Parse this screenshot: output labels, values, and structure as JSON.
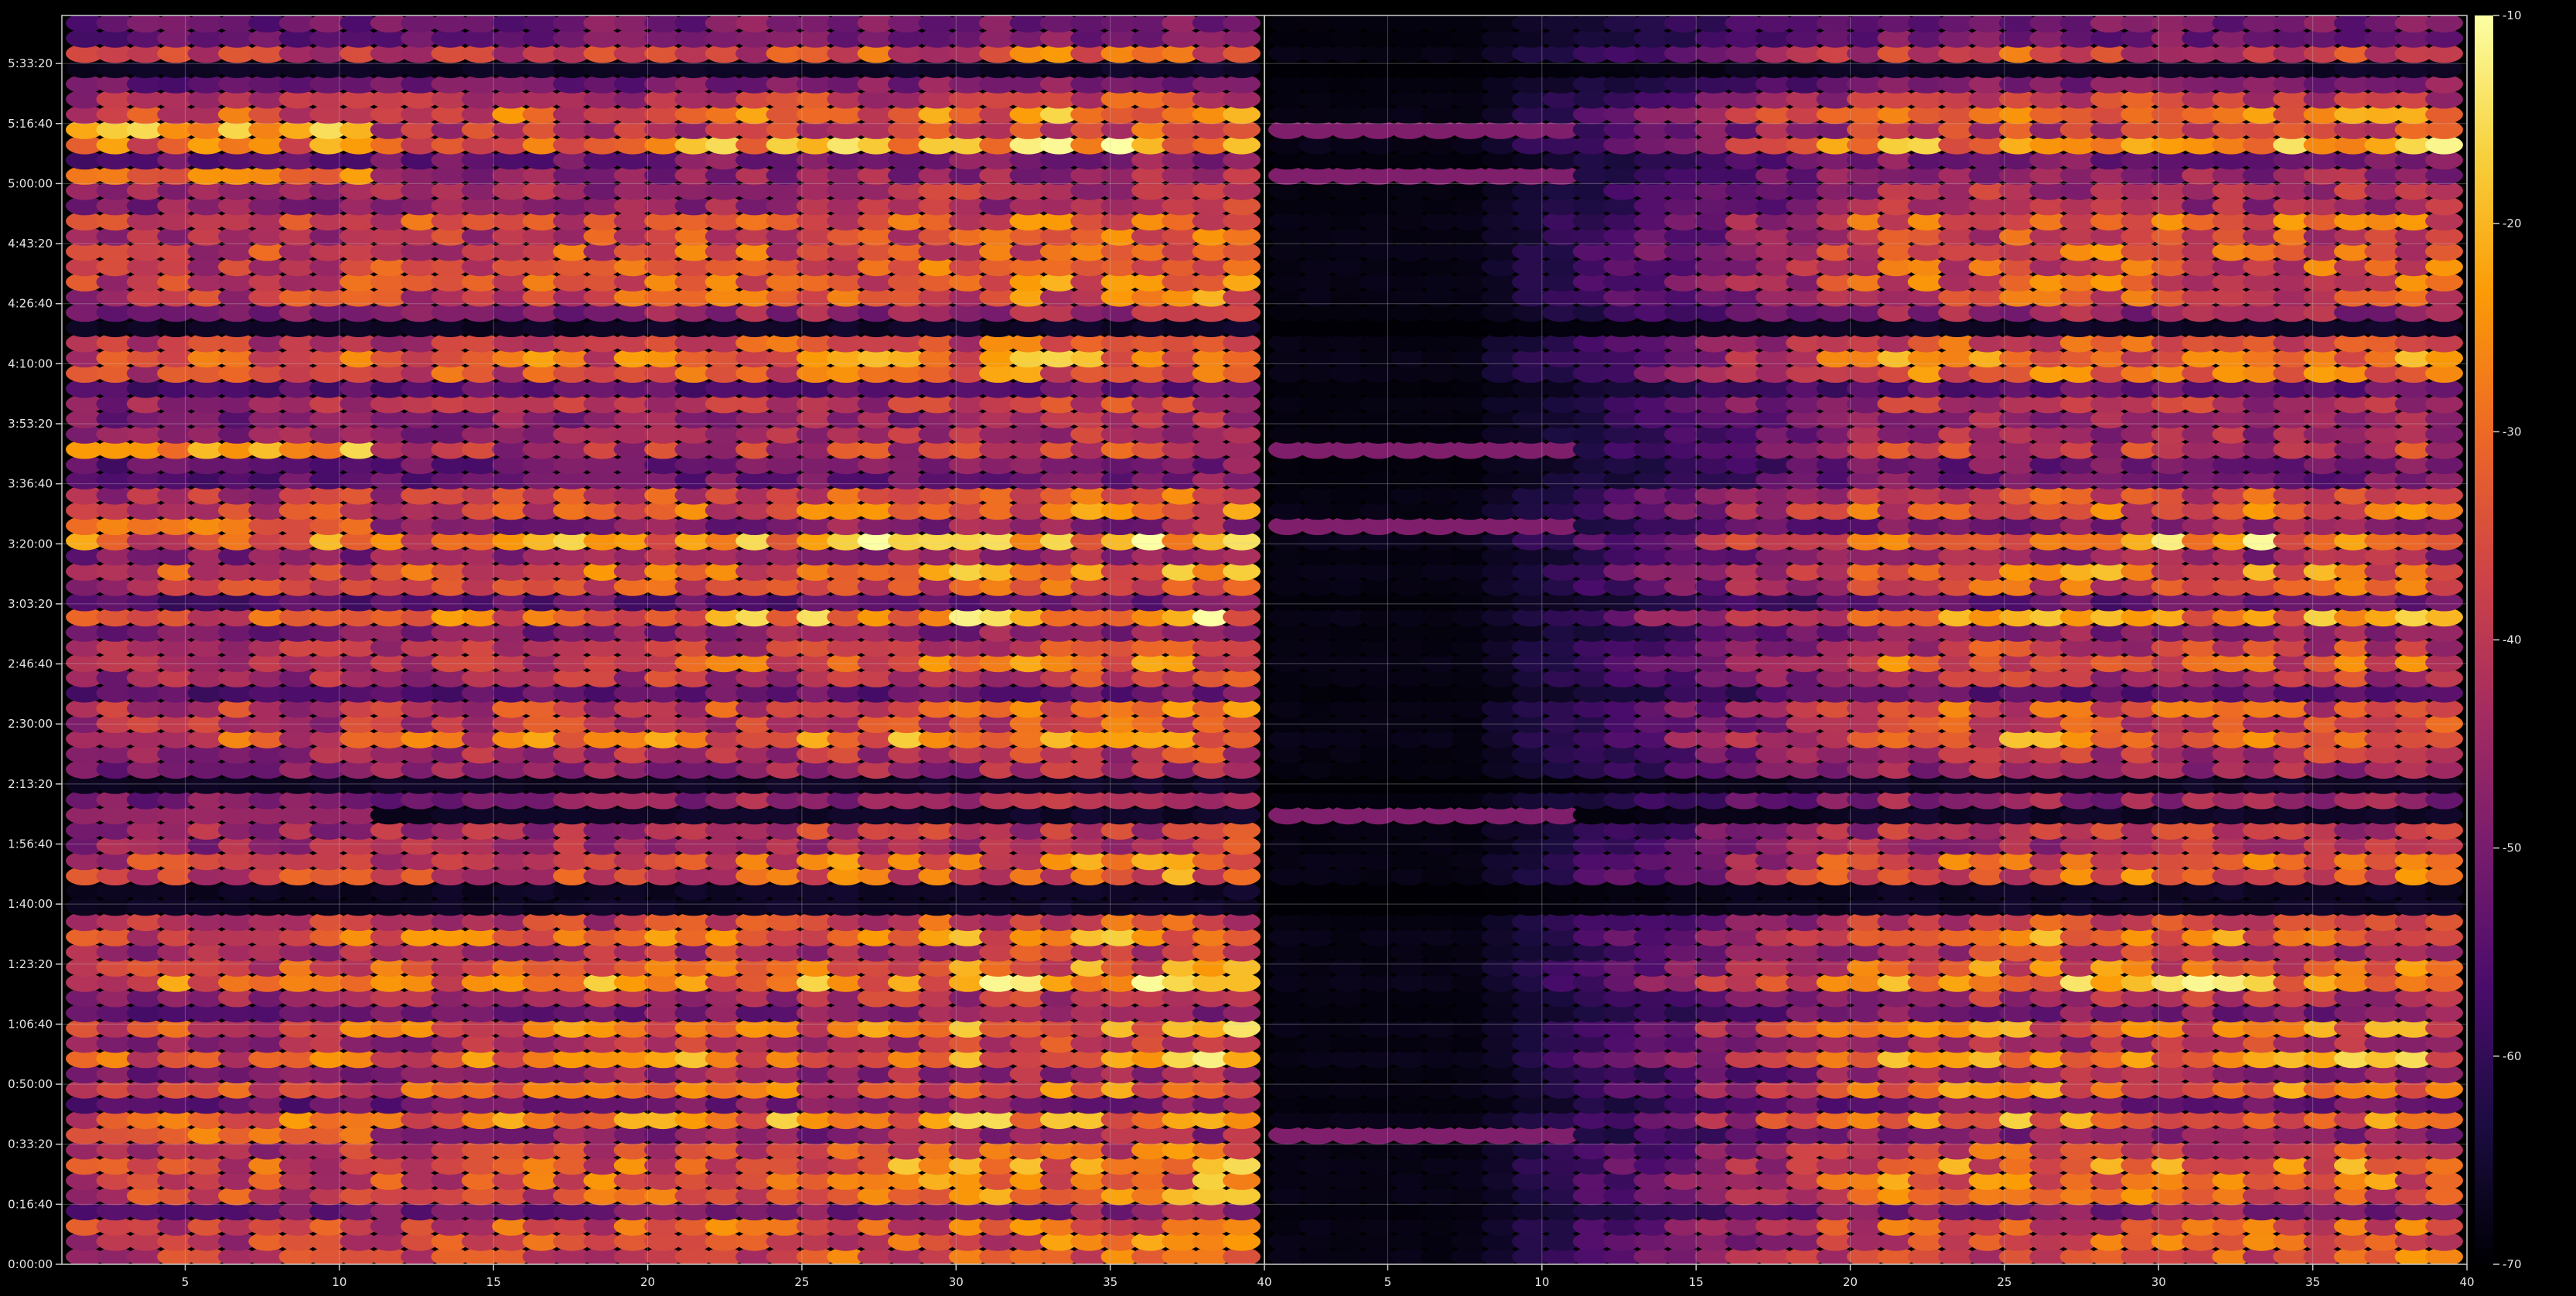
{
  "chart_data": [
    {
      "type": "heatmap",
      "title": "",
      "xlabel": "",
      "ylabel": "",
      "x_range": [
        1,
        40
      ],
      "x_ticks": [
        "5",
        "10",
        "15",
        "20",
        "25",
        "30",
        "35",
        "40"
      ],
      "y_range_seconds": [
        0,
        20800
      ],
      "y_ticks": [
        "0:00:00",
        "0:16:40",
        "0:33:20",
        "0:50:00",
        "1:06:40",
        "1:23:20",
        "1:40:00",
        "1:56:40",
        "2:13:20",
        "2:30:00",
        "2:46:40",
        "3:03:20",
        "3:20:00",
        "3:36:40",
        "3:53:20",
        "4:10:00",
        "4:26:40",
        "4:43:20",
        "5:00:00",
        "5:16:40",
        "5:33:20"
      ],
      "grid": true,
      "colormap": "inferno",
      "pattern": "ellipse grid of spectral magnitudes; strong bands across all frequency bins"
    },
    {
      "type": "heatmap",
      "title": "",
      "xlabel": "",
      "ylabel": "",
      "x_range": [
        1,
        40
      ],
      "x_ticks": [
        "5",
        "10",
        "15",
        "20",
        "25",
        "30",
        "35",
        "40"
      ],
      "y_range_seconds": [
        0,
        20800
      ],
      "y_ticks": [],
      "grid": true,
      "colormap": "inferno",
      "pattern": "same bands, low bins near -70 dB with energy rising toward higher bins"
    }
  ],
  "colorbar": {
    "min": -70,
    "max": -10,
    "ticks": [
      "-10",
      "-20",
      "-30",
      "-40",
      "-50",
      "-60",
      "-70"
    ],
    "colors": [
      "#000004",
      "#1b0c41",
      "#4a0c6b",
      "#781c6d",
      "#a52c60",
      "#cf4446",
      "#ed6925",
      "#fb9b06",
      "#f7d13d",
      "#fcffa4"
    ]
  }
}
